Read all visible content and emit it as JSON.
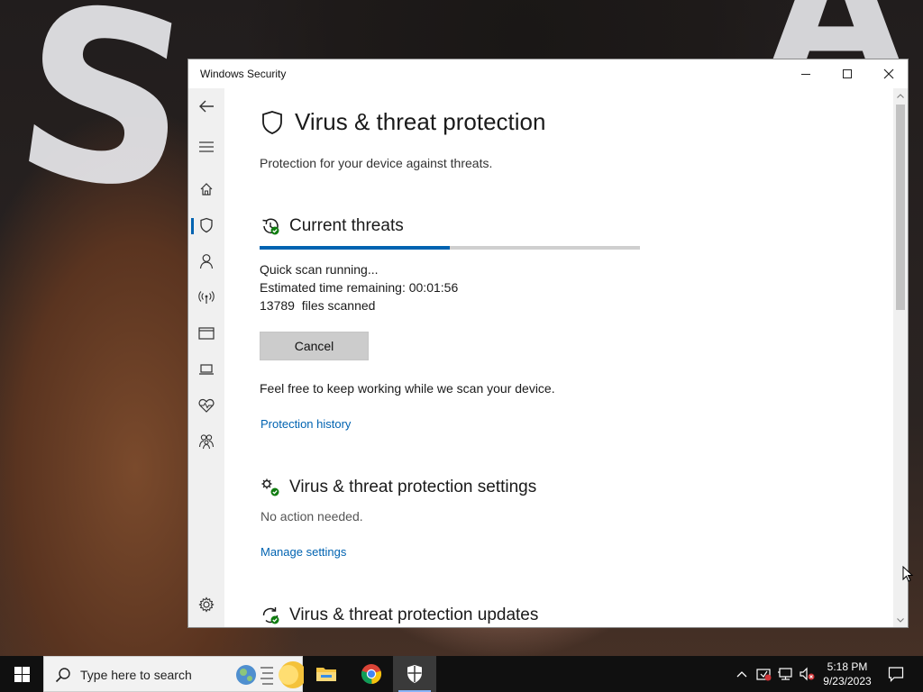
{
  "window": {
    "title": "Windows Security"
  },
  "page": {
    "title": "Virus & threat protection",
    "subtitle": "Protection for your device against threats."
  },
  "current_threats": {
    "heading": "Current threats",
    "progress": 0.5,
    "status": "Quick scan running...",
    "time_label": "Estimated time remaining:",
    "time_value": "00:01:56",
    "files_count": "13789",
    "files_label": "files scanned",
    "cancel_label": "Cancel",
    "info_text": "Feel free to keep working while we scan your device.",
    "history_link": "Protection history"
  },
  "settings_section": {
    "heading": "Virus & threat protection settings",
    "status": "No action needed.",
    "manage_link": "Manage settings"
  },
  "updates_section": {
    "heading": "Virus & threat protection updates"
  },
  "nav": {
    "items": [
      "back-arrow-icon",
      "hamburger-menu-icon",
      "home-icon",
      "shield-icon",
      "person-icon",
      "antenna-icon",
      "app-browser-icon",
      "laptop-icon",
      "heart-icon",
      "family-icon",
      "gear-icon"
    ],
    "active": "shield-icon"
  },
  "taskbar": {
    "search_placeholder": "Type here to search",
    "clock_time": "5:18 PM",
    "clock_date": "9/23/2023",
    "apps": [
      "file-explorer-icon",
      "chrome-icon",
      "windows-security-icon"
    ]
  },
  "colors": {
    "accent": "#0063b1",
    "progress_track": "#cfcfcf",
    "status_ok": "#107c10"
  }
}
